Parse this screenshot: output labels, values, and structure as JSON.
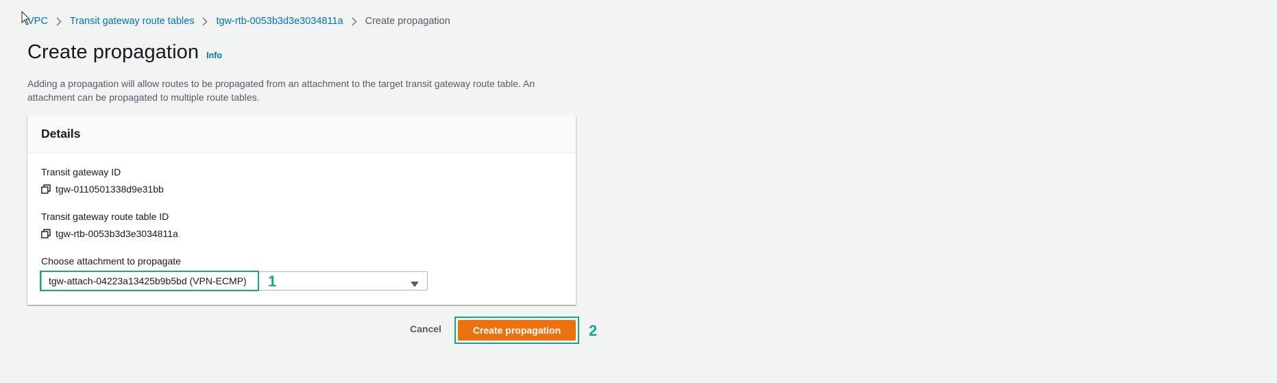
{
  "breadcrumb": {
    "items": [
      {
        "label": "VPC"
      },
      {
        "label": "Transit gateway route tables"
      },
      {
        "label": "tgw-rtb-0053b3d3e3034811a"
      }
    ],
    "current": "Create propagation"
  },
  "page": {
    "title": "Create propagation",
    "info_label": "Info",
    "description": "Adding a propagation will allow routes to be propagated from an attachment to the target transit gateway route table. An attachment can be propagated to multiple route tables."
  },
  "details": {
    "title": "Details",
    "transit_gateway_id_label": "Transit gateway ID",
    "transit_gateway_id_value": "tgw-0110501338d9e31bb",
    "route_table_id_label": "Transit gateway route table ID",
    "route_table_id_value": "tgw-rtb-0053b3d3e3034811a",
    "attachment_label": "Choose attachment to propagate",
    "attachment_selected": "tgw-attach-04223a13425b9b5bd (VPN-ECMP)"
  },
  "actions": {
    "cancel_label": "Cancel",
    "submit_label": "Create propagation"
  },
  "annotations": {
    "step1": "1",
    "step2": "2"
  },
  "icons": {
    "breadcrumb_separator": "chevron-right-icon",
    "copy": "copy-icon",
    "dropdown": "caret-down-icon"
  },
  "colors": {
    "link": "#0073bb",
    "primary_button": "#ec7211",
    "annotation": "#16a58b",
    "background": "#f2f3f3"
  }
}
